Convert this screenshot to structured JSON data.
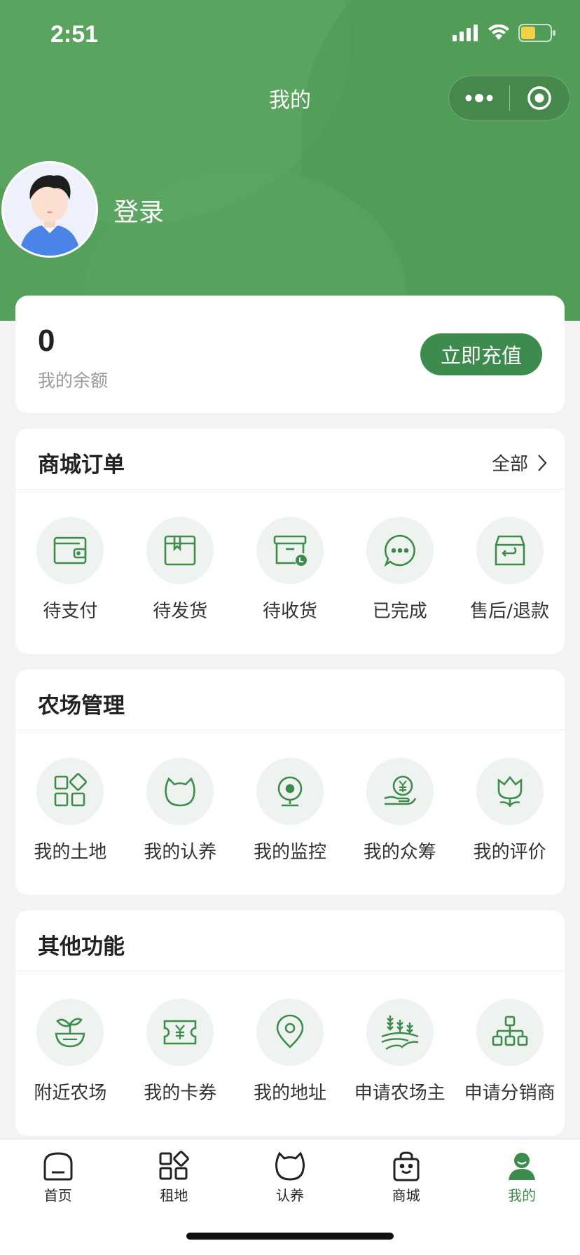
{
  "status_bar": {
    "time": "2:51"
  },
  "nav": {
    "title": "我的"
  },
  "profile": {
    "login_label": "登录"
  },
  "balance": {
    "value": "0",
    "label": "我的余额",
    "recharge_label": "立即充值"
  },
  "orders": {
    "title": "商城订单",
    "more_label": "全部",
    "items": [
      {
        "label": "待支付",
        "icon": "wallet-icon"
      },
      {
        "label": "待发货",
        "icon": "package-icon"
      },
      {
        "label": "待收货",
        "icon": "delivery-box-icon"
      },
      {
        "label": "已完成",
        "icon": "chat-bubble-icon"
      },
      {
        "label": "售后/退款",
        "icon": "return-box-icon"
      }
    ]
  },
  "farm": {
    "title": "农场管理",
    "items": [
      {
        "label": "我的土地",
        "icon": "grid-icon"
      },
      {
        "label": "我的认养",
        "icon": "cat-head-icon"
      },
      {
        "label": "我的监控",
        "icon": "camera-icon"
      },
      {
        "label": "我的众筹",
        "icon": "hand-coin-icon"
      },
      {
        "label": "我的评价",
        "icon": "flower-icon"
      }
    ]
  },
  "other": {
    "title": "其他功能",
    "items": [
      {
        "label": "附近农场",
        "icon": "sprout-pot-icon"
      },
      {
        "label": "我的卡券",
        "icon": "coupon-icon"
      },
      {
        "label": "我的地址",
        "icon": "location-pin-icon"
      },
      {
        "label": "申请农场主",
        "icon": "wheat-field-icon"
      },
      {
        "label": "申请分销商",
        "icon": "org-chart-icon"
      }
    ]
  },
  "tabbar": {
    "items": [
      {
        "label": "首页",
        "icon": "home-icon"
      },
      {
        "label": "租地",
        "icon": "grid-icon"
      },
      {
        "label": "认养",
        "icon": "cat-head-icon"
      },
      {
        "label": "商城",
        "icon": "shopping-bag-icon"
      },
      {
        "label": "我的",
        "icon": "user-icon"
      }
    ],
    "active_index": 4
  },
  "colors": {
    "header_green": "#55a05b",
    "accent_green": "#3e8b4e",
    "icon_bg": "#eff3ef"
  }
}
